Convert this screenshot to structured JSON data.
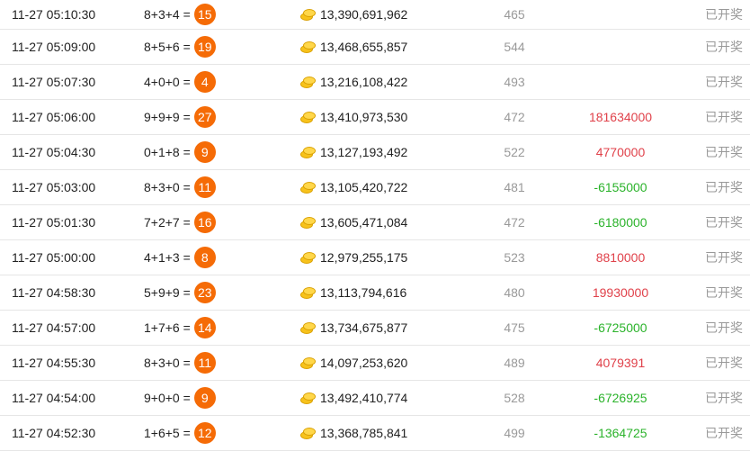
{
  "colors": {
    "ball": "#f56b06",
    "positive": "#e0414a",
    "negative": "#2bb32b",
    "muted": "#999999",
    "coin": "#f7c21b"
  },
  "icons": {
    "coin": "gold-coin-icon"
  },
  "rows": [
    {
      "time": "11-27 05:10:30",
      "formula": "8+3+4 =",
      "result": "15",
      "amount": "13,390,691,962",
      "count": "465",
      "profit": "",
      "profit_sign": "",
      "status": "已开奖"
    },
    {
      "time": "11-27 05:09:00",
      "formula": "8+5+6 =",
      "result": "19",
      "amount": "13,468,655,857",
      "count": "544",
      "profit": "",
      "profit_sign": "",
      "status": "已开奖"
    },
    {
      "time": "11-27 05:07:30",
      "formula": "4+0+0 =",
      "result": "4",
      "amount": "13,216,108,422",
      "count": "493",
      "profit": "",
      "profit_sign": "",
      "status": "已开奖"
    },
    {
      "time": "11-27 05:06:00",
      "formula": "9+9+9 =",
      "result": "27",
      "amount": "13,410,973,530",
      "count": "472",
      "profit": "181634000",
      "profit_sign": "positive",
      "status": "已开奖"
    },
    {
      "time": "11-27 05:04:30",
      "formula": "0+1+8 =",
      "result": "9",
      "amount": "13,127,193,492",
      "count": "522",
      "profit": "4770000",
      "profit_sign": "positive",
      "status": "已开奖"
    },
    {
      "time": "11-27 05:03:00",
      "formula": "8+3+0 =",
      "result": "11",
      "amount": "13,105,420,722",
      "count": "481",
      "profit": "-6155000",
      "profit_sign": "negative",
      "status": "已开奖"
    },
    {
      "time": "11-27 05:01:30",
      "formula": "7+2+7 =",
      "result": "16",
      "amount": "13,605,471,084",
      "count": "472",
      "profit": "-6180000",
      "profit_sign": "negative",
      "status": "已开奖"
    },
    {
      "time": "11-27 05:00:00",
      "formula": "4+1+3 =",
      "result": "8",
      "amount": "12,979,255,175",
      "count": "523",
      "profit": "8810000",
      "profit_sign": "positive",
      "status": "已开奖"
    },
    {
      "time": "11-27 04:58:30",
      "formula": "5+9+9 =",
      "result": "23",
      "amount": "13,113,794,616",
      "count": "480",
      "profit": "19930000",
      "profit_sign": "positive",
      "status": "已开奖"
    },
    {
      "time": "11-27 04:57:00",
      "formula": "1+7+6 =",
      "result": "14",
      "amount": "13,734,675,877",
      "count": "475",
      "profit": "-6725000",
      "profit_sign": "negative",
      "status": "已开奖"
    },
    {
      "time": "11-27 04:55:30",
      "formula": "8+3+0 =",
      "result": "11",
      "amount": "14,097,253,620",
      "count": "489",
      "profit": "4079391",
      "profit_sign": "positive",
      "status": "已开奖"
    },
    {
      "time": "11-27 04:54:00",
      "formula": "9+0+0 =",
      "result": "9",
      "amount": "13,492,410,774",
      "count": "528",
      "profit": "-6726925",
      "profit_sign": "negative",
      "status": "已开奖"
    },
    {
      "time": "11-27 04:52:30",
      "formula": "1+6+5 =",
      "result": "12",
      "amount": "13,368,785,841",
      "count": "499",
      "profit": "-1364725",
      "profit_sign": "negative",
      "status": "已开奖"
    }
  ]
}
